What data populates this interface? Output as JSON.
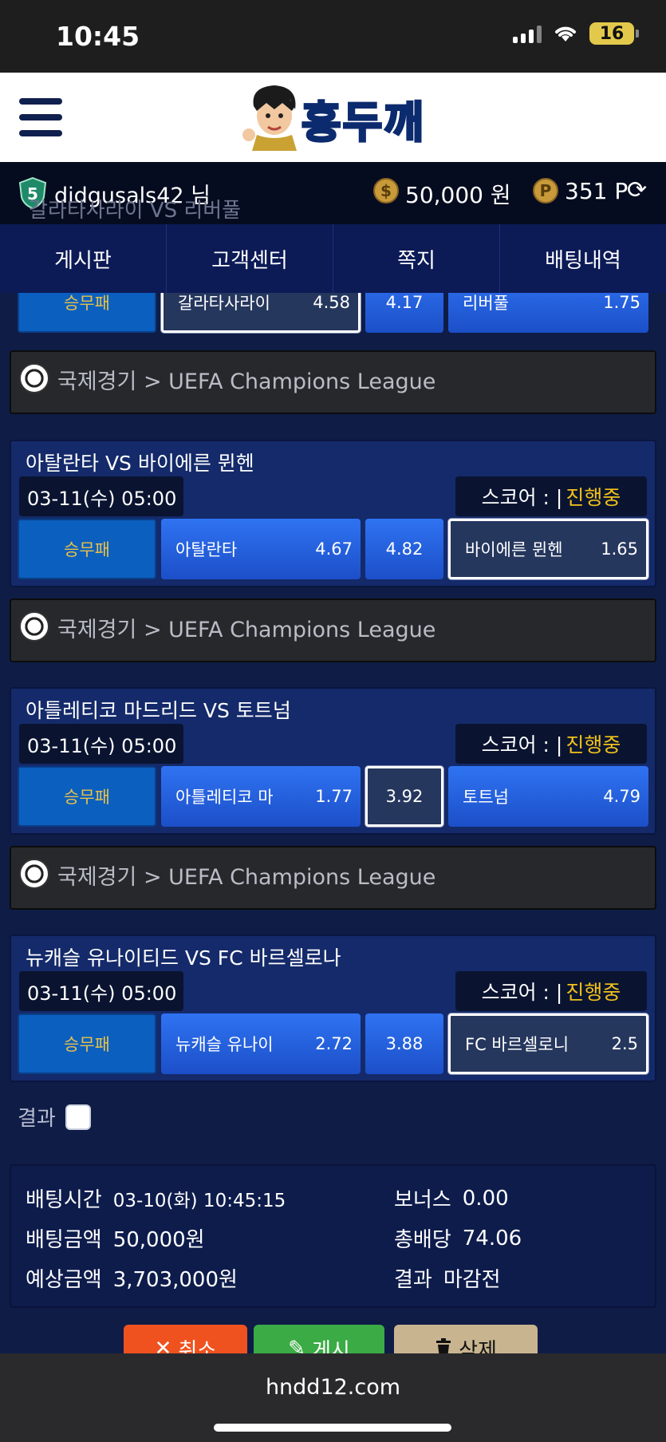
{
  "status_bar": {
    "time": "10:45",
    "battery": "16"
  },
  "header": {
    "logo_text": "홍두깨"
  },
  "user": {
    "level": "5",
    "name": "didgusals42 님",
    "money": "50,000 원",
    "points": "351 P"
  },
  "ghost_text": "갈라타사라이 VS 리버풀",
  "nav": {
    "items": [
      "게시판",
      "고객센터",
      "쪽지",
      "배팅내역"
    ]
  },
  "top_odds": {
    "type": "승무패",
    "home": "갈라타사라이",
    "home_odd": "4.58",
    "draw": "4.17",
    "away": "리버풀",
    "away_odd": "1.75"
  },
  "matches": [
    {
      "league_path": "국제경기 > UEFA Champions League",
      "title": "아탈란타 VS 바이에른 뮌헨",
      "date": "03-11(수) 05:00",
      "score_label": "스코어 : |",
      "status": "진행중",
      "type": "승무패",
      "home": "아탈란타",
      "home_odd": "4.67",
      "draw": "4.82",
      "away": "바이에른 뮌헨",
      "away_odd": "1.65"
    },
    {
      "league_path": "국제경기 > UEFA Champions League",
      "title": "아틀레티코 마드리드 VS 토트넘",
      "date": "03-11(수) 05:00",
      "score_label": "스코어 : |",
      "status": "진행중",
      "type": "승무패",
      "home": "아틀레티코 마",
      "home_odd": "1.77",
      "draw": "3.92",
      "away": "토트넘",
      "away_odd": "4.79"
    },
    {
      "league_path": "국제경기 > UEFA Champions League",
      "title": "뉴캐슬 유나이티드 VS FC 바르셀로나",
      "date": "03-11(수) 05:00",
      "score_label": "스코어 : |",
      "status": "진행중",
      "type": "승무패",
      "home": "뉴캐슬 유나이",
      "home_odd": "2.72",
      "draw": "3.88",
      "away": "FC 바르셀로니",
      "away_odd": "2.5"
    }
  ],
  "result_label": "결과",
  "summary": {
    "bet_time_label": "배팅시간",
    "bet_time": "03-10(화) 10:45:15",
    "bet_amount_label": "배팅금액",
    "bet_amount": "50,000원",
    "expected_label": "예상금액",
    "expected": "3,703,000원",
    "bonus_label": "보너스",
    "bonus": "0.00",
    "total_odds_label": "총배당",
    "total_odds": "74.06",
    "result_label": "결과",
    "result": "마감전"
  },
  "buttons": {
    "cancel": "취소",
    "post": "게시",
    "delete": "삭제"
  },
  "browser": {
    "url": "hndd12.com"
  }
}
